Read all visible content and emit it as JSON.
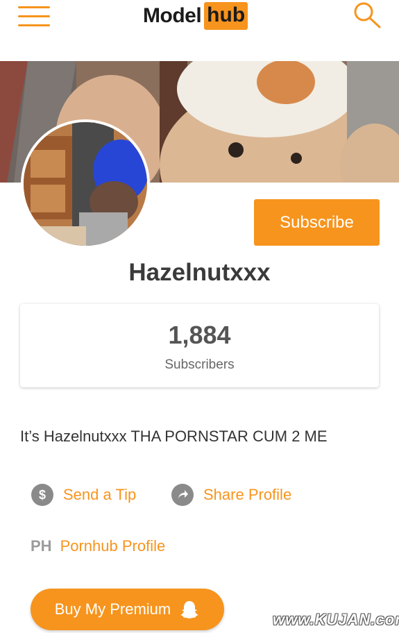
{
  "header": {
    "logo_left": "Model",
    "logo_right": "hub"
  },
  "profile": {
    "subscribe_label": "Subscribe",
    "username": "Hazelnutxxx",
    "subscriber_count": "1,884",
    "subscriber_label": "Subscribers",
    "bio": "It’s Hazelnutxxx THA PORNSTAR CUM 2 ME"
  },
  "links": {
    "tip_label": "Send a Tip",
    "share_label": "Share Profile",
    "ph_mark": "PH",
    "pornhub_label": "Pornhub Profile",
    "premium_label": "Buy My Premium"
  },
  "watermark": "www.KUJAN.com",
  "colors": {
    "accent": "#f7941d",
    "icon_gray": "#8a8a8a"
  }
}
